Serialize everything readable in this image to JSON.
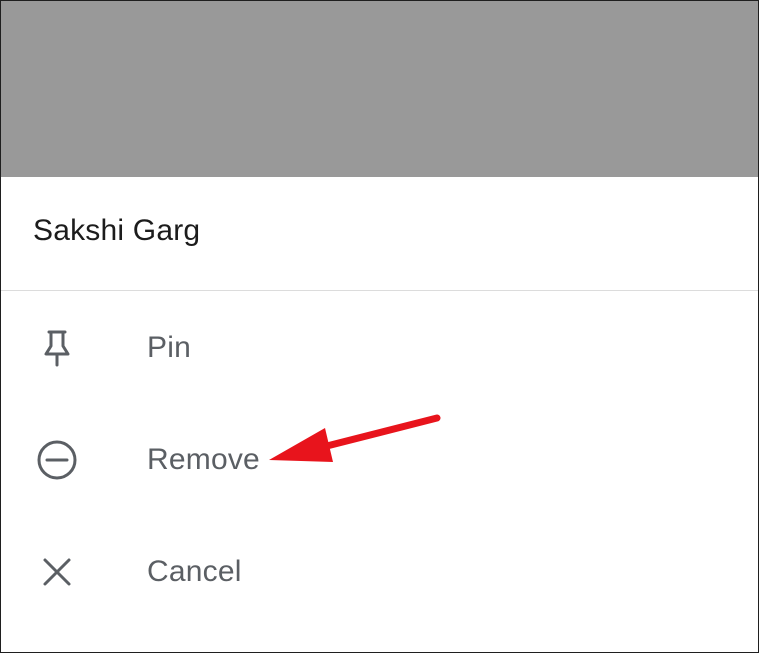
{
  "sheet": {
    "title": "Sakshi Garg",
    "items": [
      {
        "label": "Pin",
        "icon": "pin-icon"
      },
      {
        "label": "Remove",
        "icon": "minus-circle-icon"
      },
      {
        "label": "Cancel",
        "icon": "close-icon"
      }
    ]
  },
  "colors": {
    "backdrop": "#999999",
    "text_primary": "#1c1c1c",
    "text_secondary": "#5b5f64",
    "divider": "#dcdcdc",
    "annotation_arrow": "#e8141c"
  }
}
